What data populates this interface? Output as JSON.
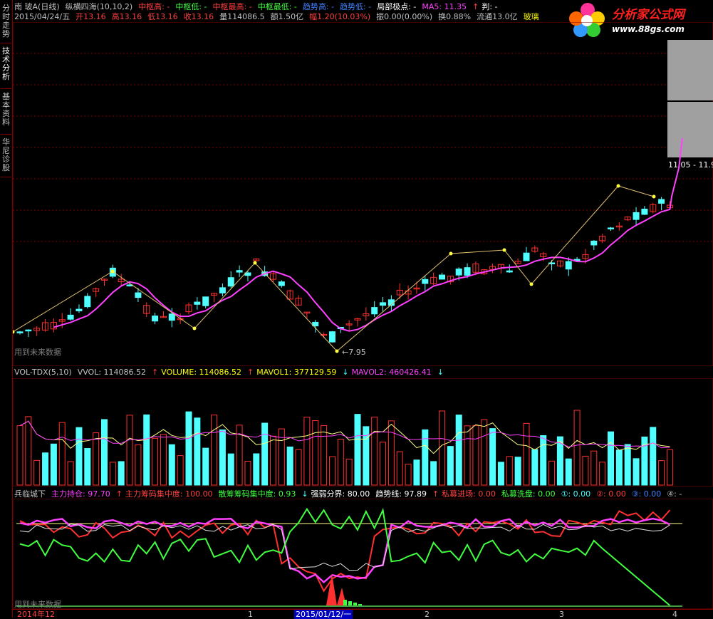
{
  "sidebar": {
    "tabs": [
      {
        "label": "分时走势"
      },
      {
        "label": "技术分析"
      },
      {
        "label": "基本资料"
      },
      {
        "label": "华尼诊股"
      }
    ]
  },
  "logo": {
    "title": "分析家公式网",
    "url_text": "www.88gs.com"
  },
  "header": {
    "line1": [
      {
        "text": "南  玻A(日线)",
        "color": "#c0c0c0"
      },
      {
        "text": "纵横四海(10,10,2)",
        "color": "#c0c0c0"
      },
      {
        "text": "中枢高: -",
        "color": "#ff4040"
      },
      {
        "text": "中枢低: -",
        "color": "#40ff40"
      },
      {
        "text": "中枢最高: -",
        "color": "#ff4040"
      },
      {
        "text": "中枢最低: -",
        "color": "#40ff40"
      },
      {
        "text": "趋势高: -",
        "color": "#4080ff"
      },
      {
        "text": "趋势低: -",
        "color": "#4080ff"
      },
      {
        "text": "局部极点: -",
        "color": "#ffffff"
      },
      {
        "text": "MA5: 11.35",
        "color": "#ff40ff"
      },
      {
        "text": "↑",
        "color": "#ff4040"
      },
      {
        "text": "判: -",
        "color": "#ffffff"
      }
    ],
    "line2": [
      {
        "text": "2015/04/24/五",
        "color": "#c0c0c0"
      },
      {
        "text": "开13.16",
        "color": "#ff4040"
      },
      {
        "text": "高13.16",
        "color": "#ff4040"
      },
      {
        "text": "低13.16",
        "color": "#ff4040"
      },
      {
        "text": "收13.16",
        "color": "#ff4040"
      },
      {
        "text": "量114086.5",
        "color": "#c0c0c0"
      },
      {
        "text": "额1.50亿",
        "color": "#c0c0c0"
      },
      {
        "text": "幅1.20(10.03%)",
        "color": "#ff4040"
      },
      {
        "text": "振0.00(0.00%)",
        "color": "#c0c0c0"
      },
      {
        "text": "换0.88%",
        "color": "#c0c0c0"
      },
      {
        "text": "流通13.0亿",
        "color": "#c0c0c0"
      },
      {
        "text": "玻璃",
        "color": "#ffff00"
      }
    ]
  },
  "main_chart": {
    "future_label": "用到未来数据",
    "low_label": "7.95",
    "price_range_label": "11.05 - 11.9"
  },
  "volume_panel": {
    "legend": [
      {
        "text": "VOL-TDX(5,10)",
        "color": "#c0c0c0"
      },
      {
        "text": "VVOL: 114086.52",
        "color": "#c0c0c0"
      },
      {
        "text": "↑",
        "color": "#ff4040"
      },
      {
        "text": "VOLUME: 114086.52",
        "color": "#ffff00"
      },
      {
        "text": "↑",
        "color": "#ff4040"
      },
      {
        "text": "MAVOL1: 377129.59",
        "color": "#ffff00"
      },
      {
        "text": "↓",
        "color": "#40ffff"
      },
      {
        "text": "MAVOL2: 460426.41",
        "color": "#ff40ff"
      },
      {
        "text": "↓",
        "color": "#40ffff"
      }
    ]
  },
  "indicator_panel": {
    "legend": [
      {
        "text": "兵临城下",
        "color": "#c0c0c0"
      },
      {
        "text": "主力持仓: 97.70",
        "color": "#ff40ff"
      },
      {
        "text": "↑",
        "color": "#ff4040"
      },
      {
        "text": "主力筹码集中度: 100.00",
        "color": "#ff4040"
      },
      {
        "text": "散筹筹码集中度: 0.93",
        "color": "#40ff40"
      },
      {
        "text": "↓",
        "color": "#40ffff"
      },
      {
        "text": "强弱分界: 80.00",
        "color": "#ffffff"
      },
      {
        "text": "趋势线: 97.89",
        "color": "#ffffff"
      },
      {
        "text": "↑",
        "color": "#ff4040"
      },
      {
        "text": "私募进场: 0.00",
        "color": "#ff4040"
      },
      {
        "text": "私募洗盘: 0.00",
        "color": "#40ff40"
      },
      {
        "text": "①: 0.00",
        "color": "#40ffff"
      },
      {
        "text": "②: 0.00",
        "color": "#ff4040"
      },
      {
        "text": "③: 0.00",
        "color": "#4080ff"
      },
      {
        "text": "④: -",
        "color": "#c0c0c0"
      }
    ],
    "future_label": "用到未来数据"
  },
  "time_axis": {
    "labels": [
      {
        "text": "2014年12"
      },
      {
        "text": "1"
      },
      {
        "text": "2015/01/12/一"
      },
      {
        "text": "2"
      },
      {
        "text": "3"
      },
      {
        "text": "4"
      }
    ]
  },
  "colors": {
    "up": "#ff3030",
    "down": "#50ffff",
    "ma": "#ff40ff",
    "grid": "#800000"
  }
}
